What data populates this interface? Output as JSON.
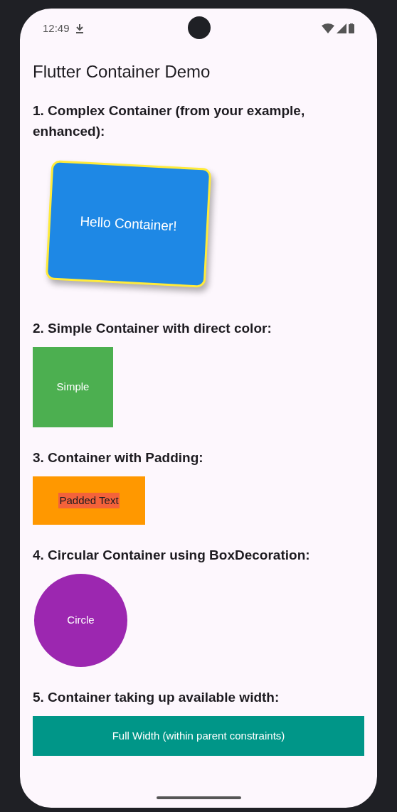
{
  "status_bar": {
    "time": "12:49"
  },
  "app_bar": {
    "title": "Flutter Container Demo"
  },
  "sections": [
    {
      "heading": "1. Complex Container (from your example, enhanced):",
      "kind": "rotated",
      "label": "Hello Container!"
    },
    {
      "heading": "2. Simple Container with direct color:",
      "kind": "square",
      "label": "Simple"
    },
    {
      "heading": "3. Container with Padding:",
      "kind": "padded",
      "label": "Padded Text"
    },
    {
      "heading": "4. Circular Container using BoxDecoration:",
      "kind": "circle",
      "label": "Circle"
    },
    {
      "heading": "5. Container taking up available width:",
      "kind": "full",
      "label": "Full Width (within parent constraints)"
    }
  ]
}
